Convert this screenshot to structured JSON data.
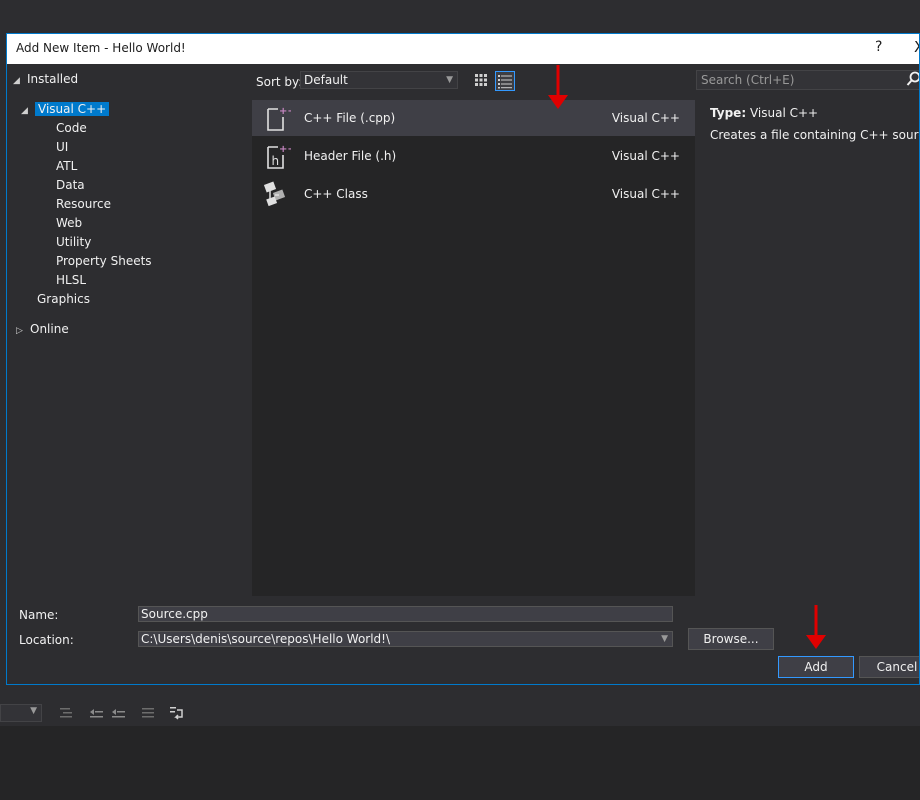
{
  "dialog": {
    "title": "Add New Item - Hello World!",
    "help_label": "?",
    "close_label": "X"
  },
  "tree": {
    "installed": "Installed",
    "visual_cpp": "Visual C++",
    "children": [
      "Code",
      "UI",
      "ATL",
      "Data",
      "Resource",
      "Web",
      "Utility",
      "Property Sheets",
      "HLSL"
    ],
    "graphics": "Graphics",
    "online": "Online"
  },
  "toolbar": {
    "sort_label": "Sort by:",
    "sort_value": "Default",
    "view_mode": "list"
  },
  "items": [
    {
      "name": "C++ File (.cpp)",
      "lang": "Visual C++",
      "icon": "cpp-file-icon",
      "selected": true
    },
    {
      "name": "Header File (.h)",
      "lang": "Visual C++",
      "icon": "header-file-icon",
      "selected": false
    },
    {
      "name": "C++ Class",
      "lang": "Visual C++",
      "icon": "cpp-class-icon",
      "selected": false
    }
  ],
  "search": {
    "placeholder": "Search (Ctrl+E)"
  },
  "info": {
    "type_label": "Type:",
    "type_value": "Visual C++",
    "description": "Creates a file containing C++ source code"
  },
  "form": {
    "name_label": "Name:",
    "name_value": "Source.cpp",
    "location_label": "Location:",
    "location_value": "C:\\Users\\denis\\source\\repos\\Hello World!\\",
    "browse_label": "Browse...",
    "add_label": "Add",
    "cancel_label": "Cancel"
  },
  "colors": {
    "accent": "#007acc",
    "annotation_arrow": "#e00000"
  }
}
